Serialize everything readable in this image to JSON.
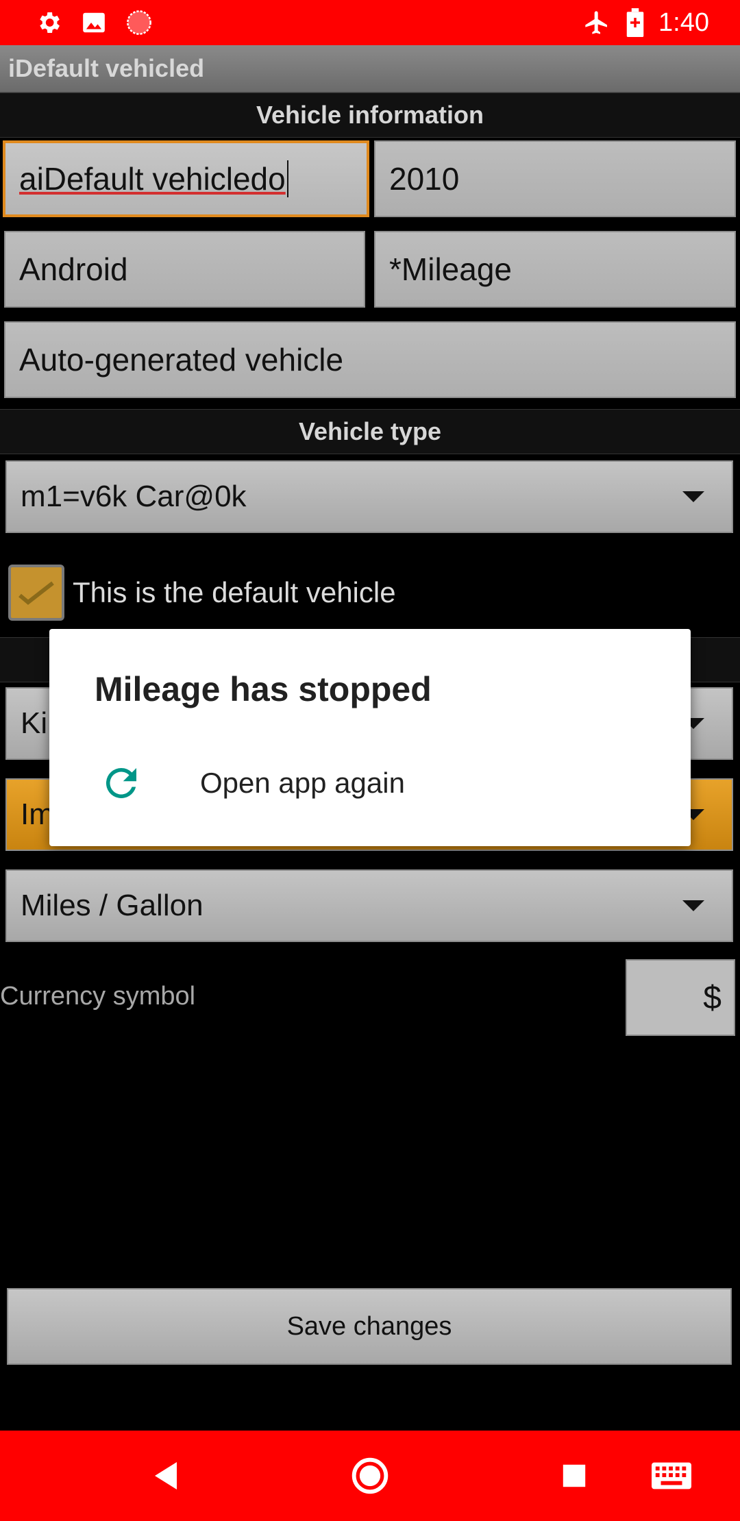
{
  "status_bar": {
    "time": "1:40",
    "icons": [
      "gear-icon",
      "image-icon",
      "record-icon",
      "airplane-icon",
      "battery-icon"
    ],
    "color": "#ff0000"
  },
  "title_bar": {
    "title": "iDefault vehicled"
  },
  "vehicle_info": {
    "section_title": "Vehicle information",
    "name_value": "aiDefault vehicledo",
    "year_value": "2010",
    "make_value": "Android",
    "model_value": "*Mileage",
    "description_value": "Auto-generated vehicle"
  },
  "vehicle_type": {
    "section_title": "Vehicle type",
    "selected": "m1=v6k Car@0k"
  },
  "default_checkbox": {
    "label": "This is the default vehicle",
    "checked": true
  },
  "units": {
    "distance_partial": "Ki",
    "volume_partial": "Im",
    "economy_selected": "Miles / Gallon"
  },
  "currency": {
    "label": "Currency symbol",
    "value": "$"
  },
  "save_button": {
    "label": "Save changes"
  },
  "dialog": {
    "title": "Mileage has stopped",
    "action_label": "Open app again",
    "action_icon": "refresh-icon",
    "accent_color": "#009688"
  },
  "nav_bar": {
    "icons": [
      "back-icon",
      "home-icon",
      "recents-icon",
      "keyboard-icon"
    ]
  }
}
